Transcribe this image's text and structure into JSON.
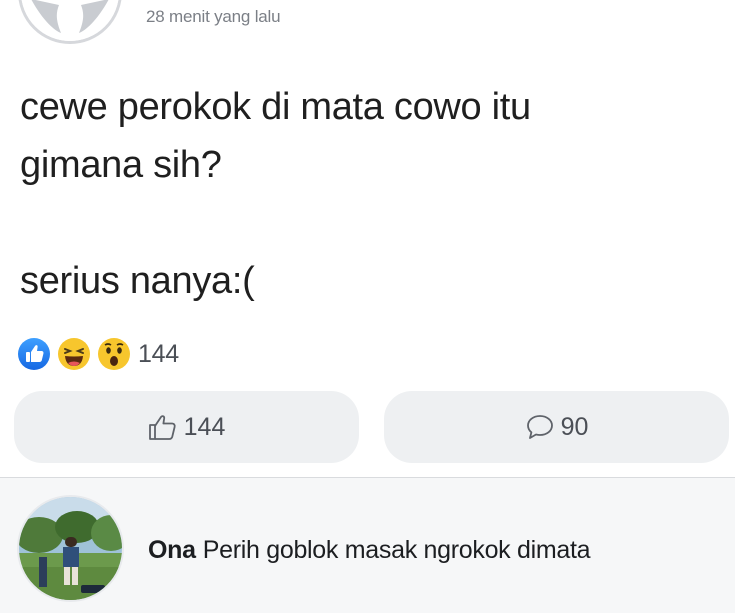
{
  "post": {
    "timestamp": "28 menit yang lalu",
    "text_lines": [
      "cewe perokok di mata cowo itu",
      "gimana sih?"
    ],
    "text_line_after_gap": "serius nanya:("
  },
  "reactions": {
    "types": [
      "like-icon",
      "haha-icon",
      "wow-icon"
    ],
    "count": "144"
  },
  "actions": {
    "like_count": "144",
    "comment_count": "90"
  },
  "comment": {
    "author": "Ona",
    "text": "Perih goblok masak ngrokok dimata"
  },
  "colors": {
    "like_blue": "#1877f2",
    "emoji_yellow": "#f7c62d",
    "button_bg": "#eef0f2",
    "comment_bg": "#f6f7f8"
  }
}
